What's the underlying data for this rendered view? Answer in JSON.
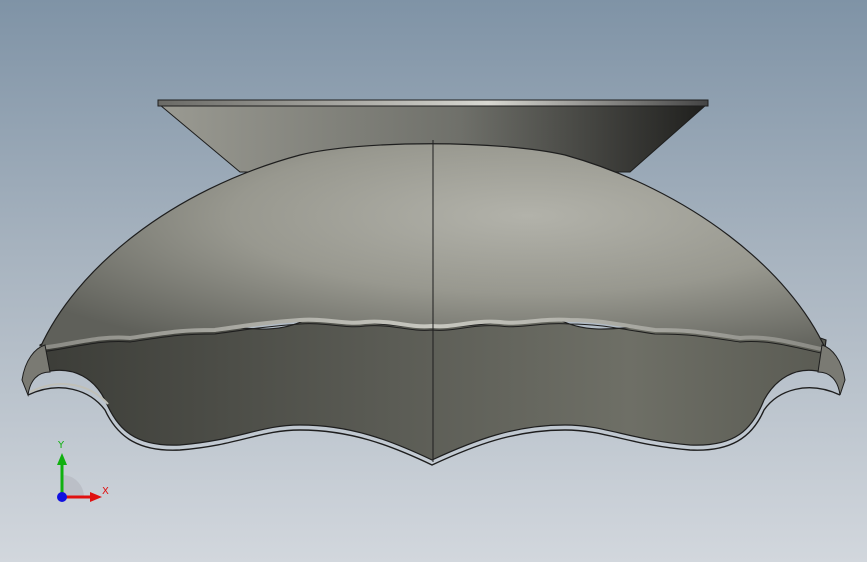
{
  "viewport": {
    "background_top": "#7f93a6",
    "background_bottom": "#d2d7dd"
  },
  "model": {
    "shell_color": "#8f8f86",
    "inner_color": "#55564f",
    "edge_color": "#1e1e1e"
  },
  "triad": {
    "x_label": "X",
    "y_label": "Y",
    "x_color": "#e01010",
    "y_color": "#10b010",
    "z_color": "#1010e0"
  }
}
